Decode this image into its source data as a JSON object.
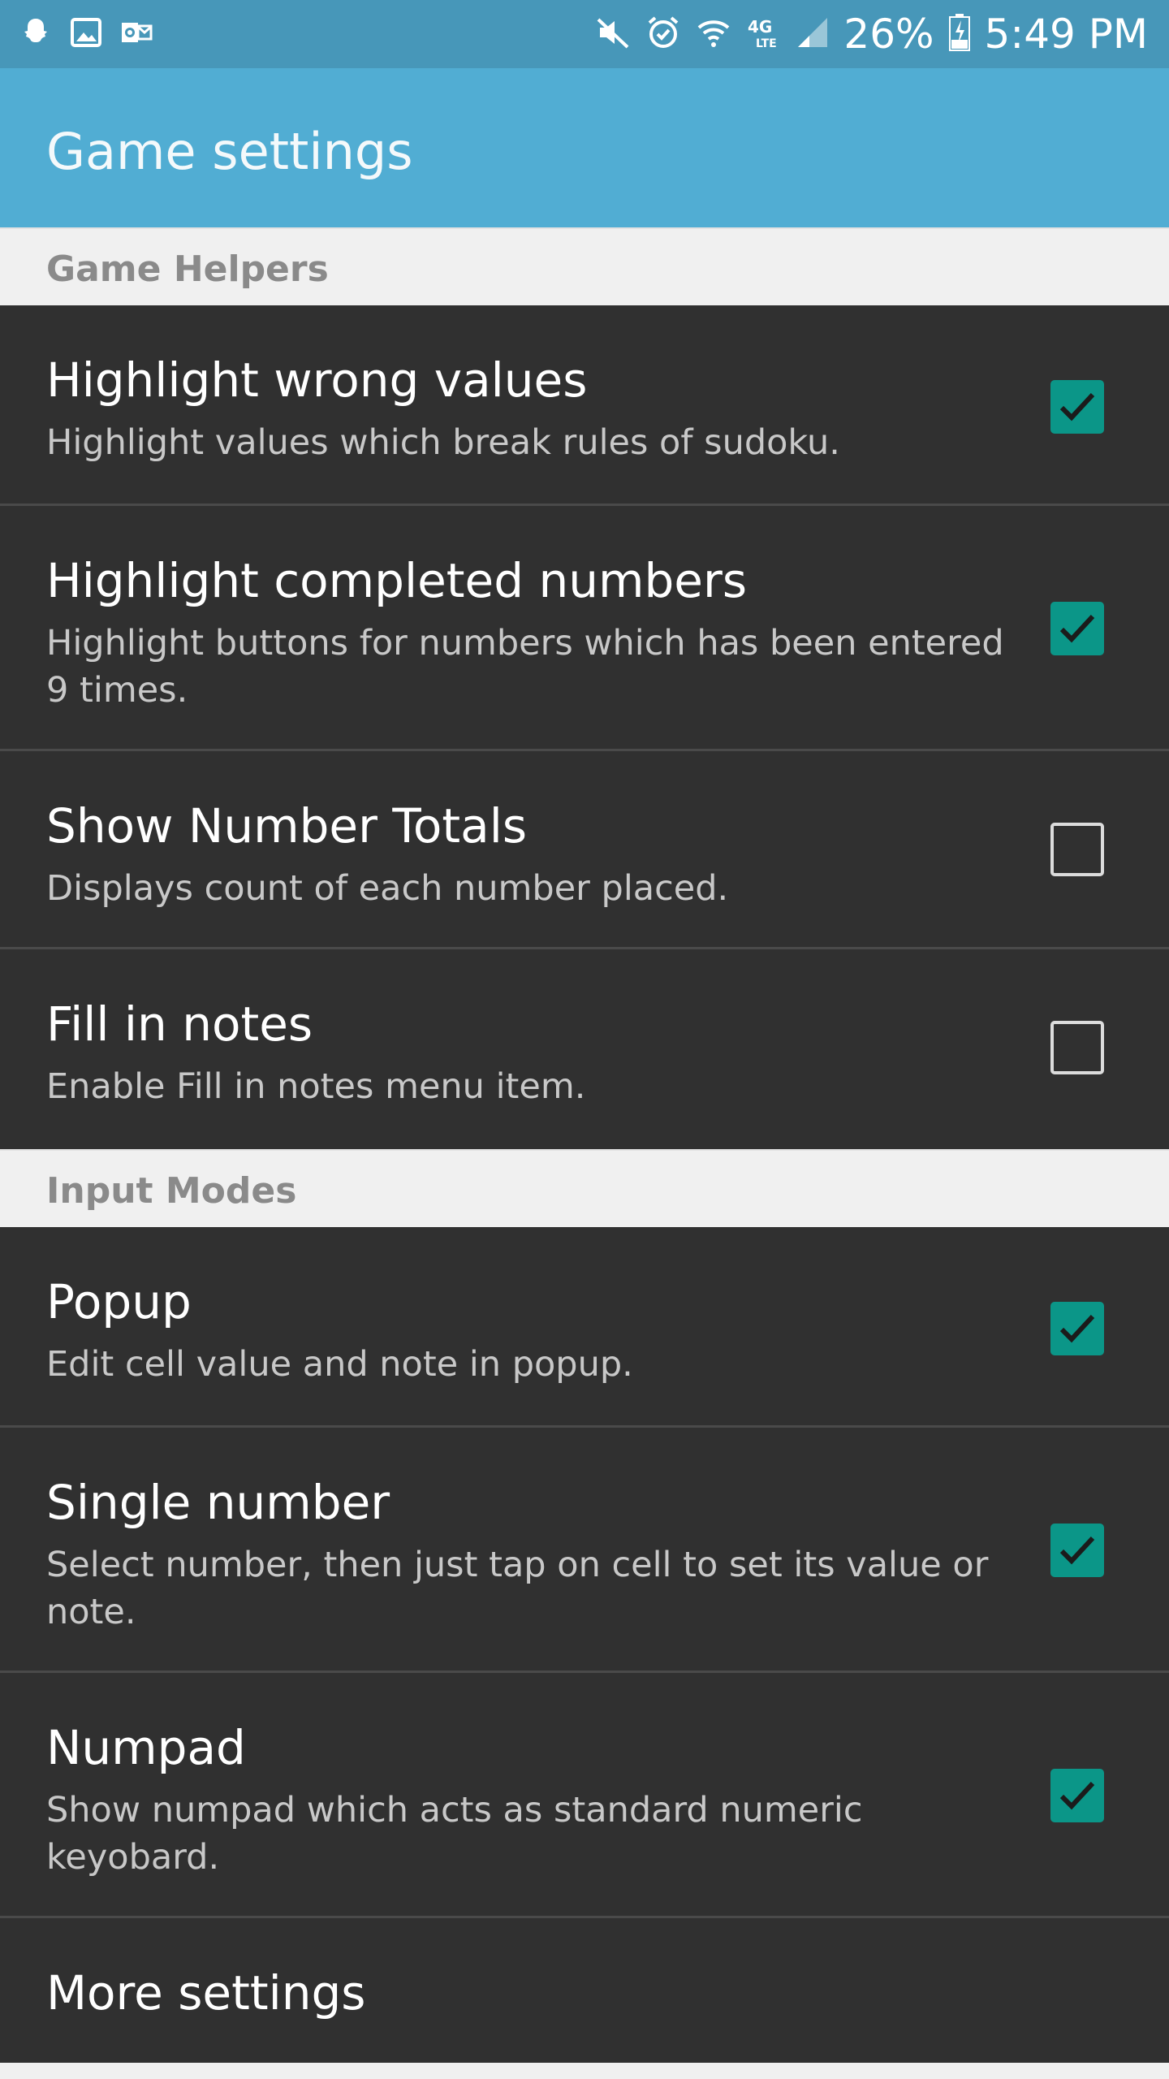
{
  "status_bar": {
    "battery_percent": "26%",
    "time": "5:49 PM",
    "network_label": "4G",
    "lte_label": "LTE",
    "icons": [
      "snapchat-icon",
      "gallery-icon",
      "outlook-icon",
      "mute-icon",
      "alarm-icon",
      "wifi-icon",
      "network-4g-icon",
      "signal-icon",
      "battery-charging-icon"
    ]
  },
  "header": {
    "title": "Game settings"
  },
  "sections": [
    {
      "title": "Game Helpers",
      "items": [
        {
          "title": "Highlight wrong values",
          "summary": "Highlight values which break rules of sudoku.",
          "checked": true
        },
        {
          "title": "Highlight completed numbers",
          "summary": "Highlight buttons for numbers which has been entered 9 times.",
          "checked": true
        },
        {
          "title": "Show Number Totals",
          "summary": "Displays count of each number placed.",
          "checked": false
        },
        {
          "title": "Fill in notes",
          "summary": "Enable Fill in notes menu item.",
          "checked": false
        }
      ]
    },
    {
      "title": "Input Modes",
      "items": [
        {
          "title": "Popup",
          "summary": "Edit cell value and note in popup.",
          "checked": true
        },
        {
          "title": "Single number",
          "summary": "Select number, then just tap on cell to set its value or note.",
          "checked": true
        },
        {
          "title": "Numpad",
          "summary": "Show numpad which acts as standard numeric keyobard.",
          "checked": true
        }
      ]
    }
  ],
  "more_settings": {
    "title": "More settings"
  },
  "colors": {
    "status_bar": "#4797b9",
    "app_bar": "#51add3",
    "item_background": "#303030",
    "checkbox_checked": "#0b9688",
    "section_header_text": "#8a8a8a"
  }
}
